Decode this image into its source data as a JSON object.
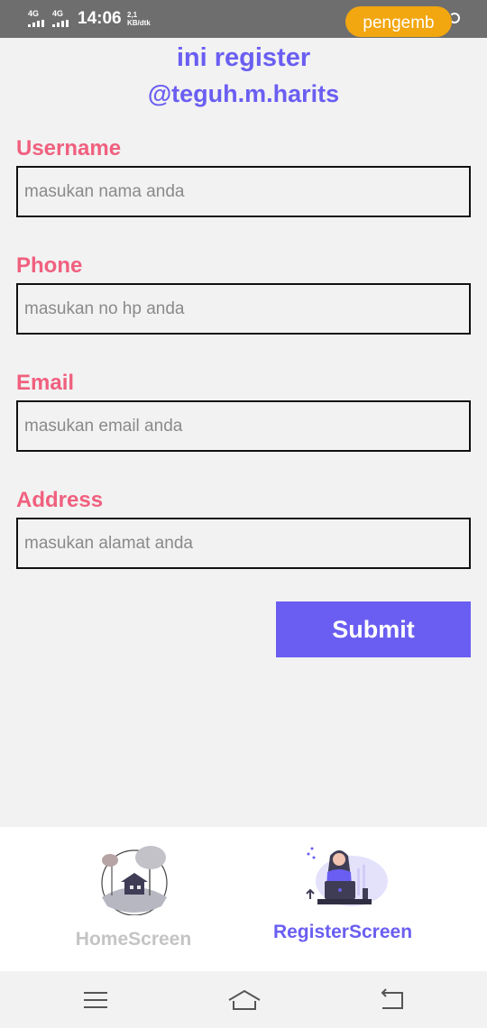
{
  "status_bar": {
    "sim1": "4G",
    "sim2": "4G",
    "time": "14:06",
    "speed_value": "2,1",
    "speed_unit": "KB/dtk",
    "notification": "pengemb"
  },
  "header": {
    "title": "ini register",
    "subtitle": "@teguh.m.harits"
  },
  "form": {
    "username": {
      "label": "Username",
      "placeholder": "masukan nama anda",
      "value": ""
    },
    "phone": {
      "label": "Phone",
      "placeholder": "masukan no hp anda",
      "value": ""
    },
    "email": {
      "label": "Email",
      "placeholder": "masukan email anda",
      "value": ""
    },
    "address": {
      "label": "Address",
      "placeholder": "masukan alamat anda",
      "value": ""
    },
    "submit_label": "Submit"
  },
  "tabs": [
    {
      "label": "HomeScreen",
      "icon": "home-illustration-icon",
      "active": false
    },
    {
      "label": "RegisterScreen",
      "icon": "register-illustration-icon",
      "active": true
    }
  ],
  "nav_bar": {
    "icons": [
      "menu-icon",
      "home-icon",
      "back-icon"
    ]
  },
  "colors": {
    "accent": "#6a5ef2",
    "label": "#f0607e",
    "tab_inactive": "#c4c4c4",
    "status_bar": "#6e6e6e",
    "notification_pill": "#f2a60f",
    "background": "#f2f2f2"
  }
}
